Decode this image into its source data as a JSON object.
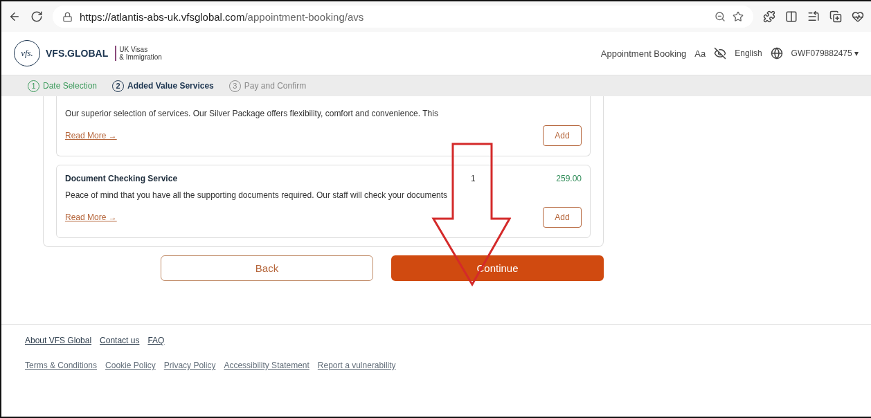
{
  "browser": {
    "url_host": "https://atlantis-abs-uk.vfsglobal.com",
    "url_path": "/appointment-booking/avs"
  },
  "header": {
    "brand": "VFS.GLOBAL",
    "logo_text": "vfs.",
    "partner_line1": "UK Visas",
    "partner_line2": "& Immigration",
    "nav_link": "Appointment Booking",
    "font_toggle": "Aa",
    "language": "English",
    "account": "GWF079882475 ▾"
  },
  "steps": [
    {
      "number": "1",
      "label": "Date Selection",
      "done": true,
      "selected": false
    },
    {
      "number": "2",
      "label": "Added Value Services",
      "done": false,
      "selected": true
    },
    {
      "number": "3",
      "label": "Pay and Confirm",
      "done": false,
      "selected": false
    }
  ],
  "services": [
    {
      "description": "Our superior selection of services. Our Silver Package offers flexibility, comfort and convenience. This",
      "read_more": "Read More →",
      "add": "Add",
      "clipped": true
    },
    {
      "title": "Document Checking Service",
      "quantity": "1",
      "price": "259.00",
      "description": "Peace of mind that you have all the supporting documents required. Our staff will check your documents",
      "read_more": "Read More →",
      "add": "Add",
      "clipped": false
    }
  ],
  "buttons": {
    "back": "Back",
    "continue": "Continue"
  },
  "footer": {
    "row1": [
      "About VFS Global",
      "Contact us",
      "FAQ"
    ],
    "row2": [
      "Terms & Conditions",
      "Cookie Policy",
      "Privacy Policy",
      "Accessibility Statement",
      "Report a vulnerability"
    ]
  }
}
